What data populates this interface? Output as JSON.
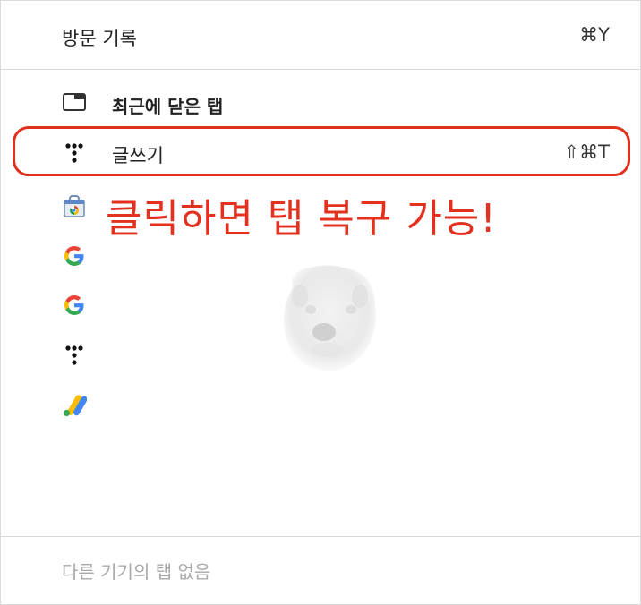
{
  "header": {
    "title": "방문 기록",
    "shortcut": "⌘Y"
  },
  "recent": {
    "title": "최근에 닫은 탭",
    "items": [
      {
        "label": "글쓰기",
        "shortcut": "⇧⌘T",
        "icon": "tistory-icon"
      },
      {
        "label": "",
        "icon": "chrome-web-store-icon"
      },
      {
        "label": "",
        "icon": "google-icon"
      },
      {
        "label": "",
        "icon": "google-icon"
      },
      {
        "label": "",
        "icon": "tistory-icon"
      },
      {
        "label": "",
        "icon": "google-ads-icon"
      }
    ]
  },
  "annotation": {
    "text": "클릭하면 탭 복구 가능!",
    "color": "#e4311f"
  },
  "footer": {
    "text": "다른 기기의 탭 없음"
  },
  "colors": {
    "highlight": "#e0311d",
    "text": "#222222",
    "muted": "#a8a8a8"
  }
}
